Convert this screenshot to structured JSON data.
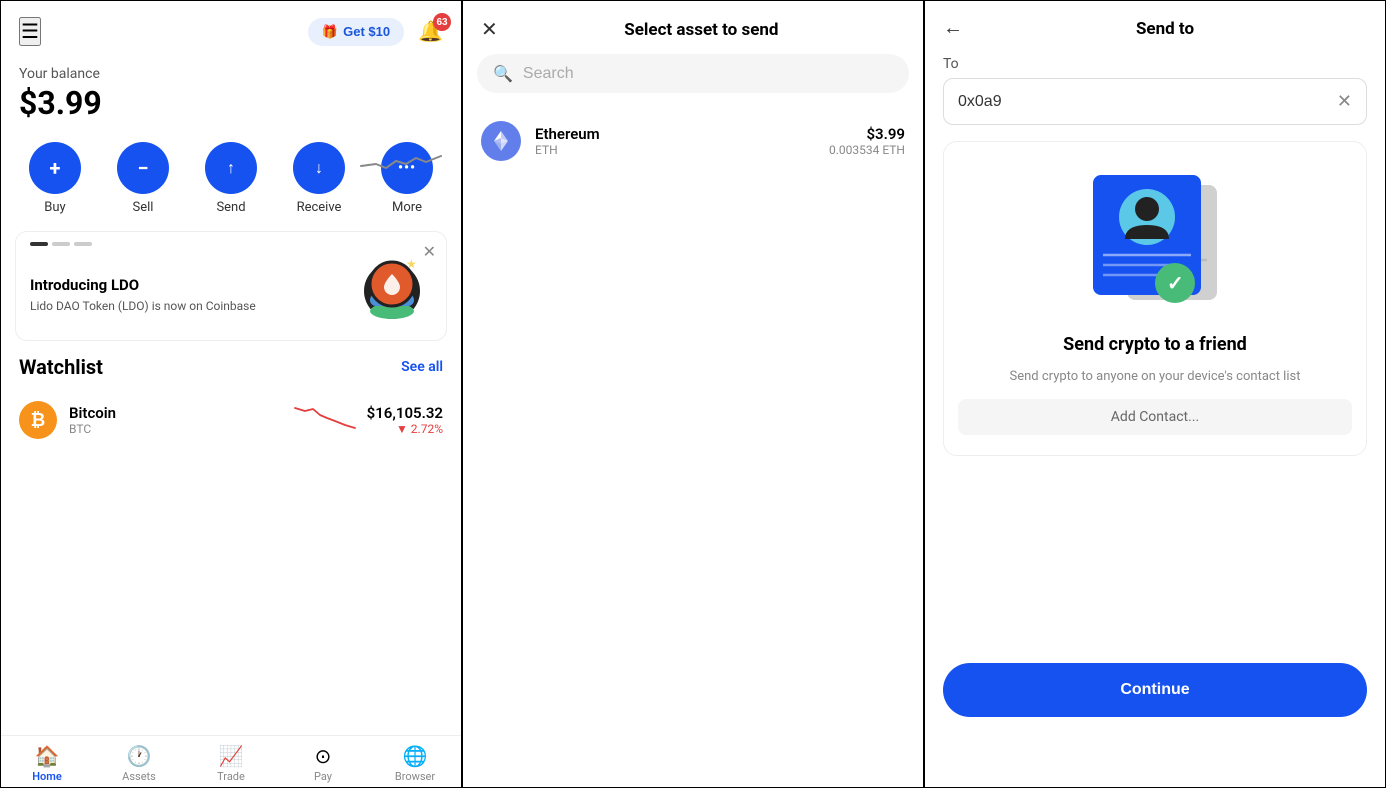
{
  "left": {
    "get_btn": "Get $10",
    "notif_count": "63",
    "balance_label": "Your balance",
    "balance_amount": "$3.99",
    "actions": [
      {
        "label": "Buy",
        "icon": "+"
      },
      {
        "label": "Sell",
        "icon": "−"
      },
      {
        "label": "Send",
        "icon": "↑"
      },
      {
        "label": "Receive",
        "icon": "↓"
      },
      {
        "label": "More",
        "icon": "•••"
      }
    ],
    "promo": {
      "title": "Introducing LDO",
      "desc": "Lido DAO Token (LDO) is now on Coinbase"
    },
    "watchlist_title": "Watchlist",
    "see_all": "See all",
    "btc": {
      "name": "Bitcoin",
      "ticker": "BTC",
      "price": "$16,105.32",
      "change": "▼ 2.72%"
    },
    "nav": [
      {
        "label": "Home",
        "active": true
      },
      {
        "label": "Assets",
        "active": false
      },
      {
        "label": "Trade",
        "active": false
      },
      {
        "label": "Pay",
        "active": false
      },
      {
        "label": "Browser",
        "active": false
      }
    ]
  },
  "mid": {
    "title": "Select asset to send",
    "search_placeholder": "Search",
    "close_icon": "×",
    "eth": {
      "name": "Ethereum",
      "ticker": "ETH",
      "price": "$3.99",
      "amount": "0.003534 ETH"
    }
  },
  "right": {
    "title": "Send to",
    "back_icon": "←",
    "to_label": "To",
    "to_value": "0x0a9",
    "clear_icon": "×",
    "friend_title": "Send crypto to a friend",
    "friend_desc": "Send crypto to anyone on your device's contact list",
    "continue_btn": "Continue"
  }
}
